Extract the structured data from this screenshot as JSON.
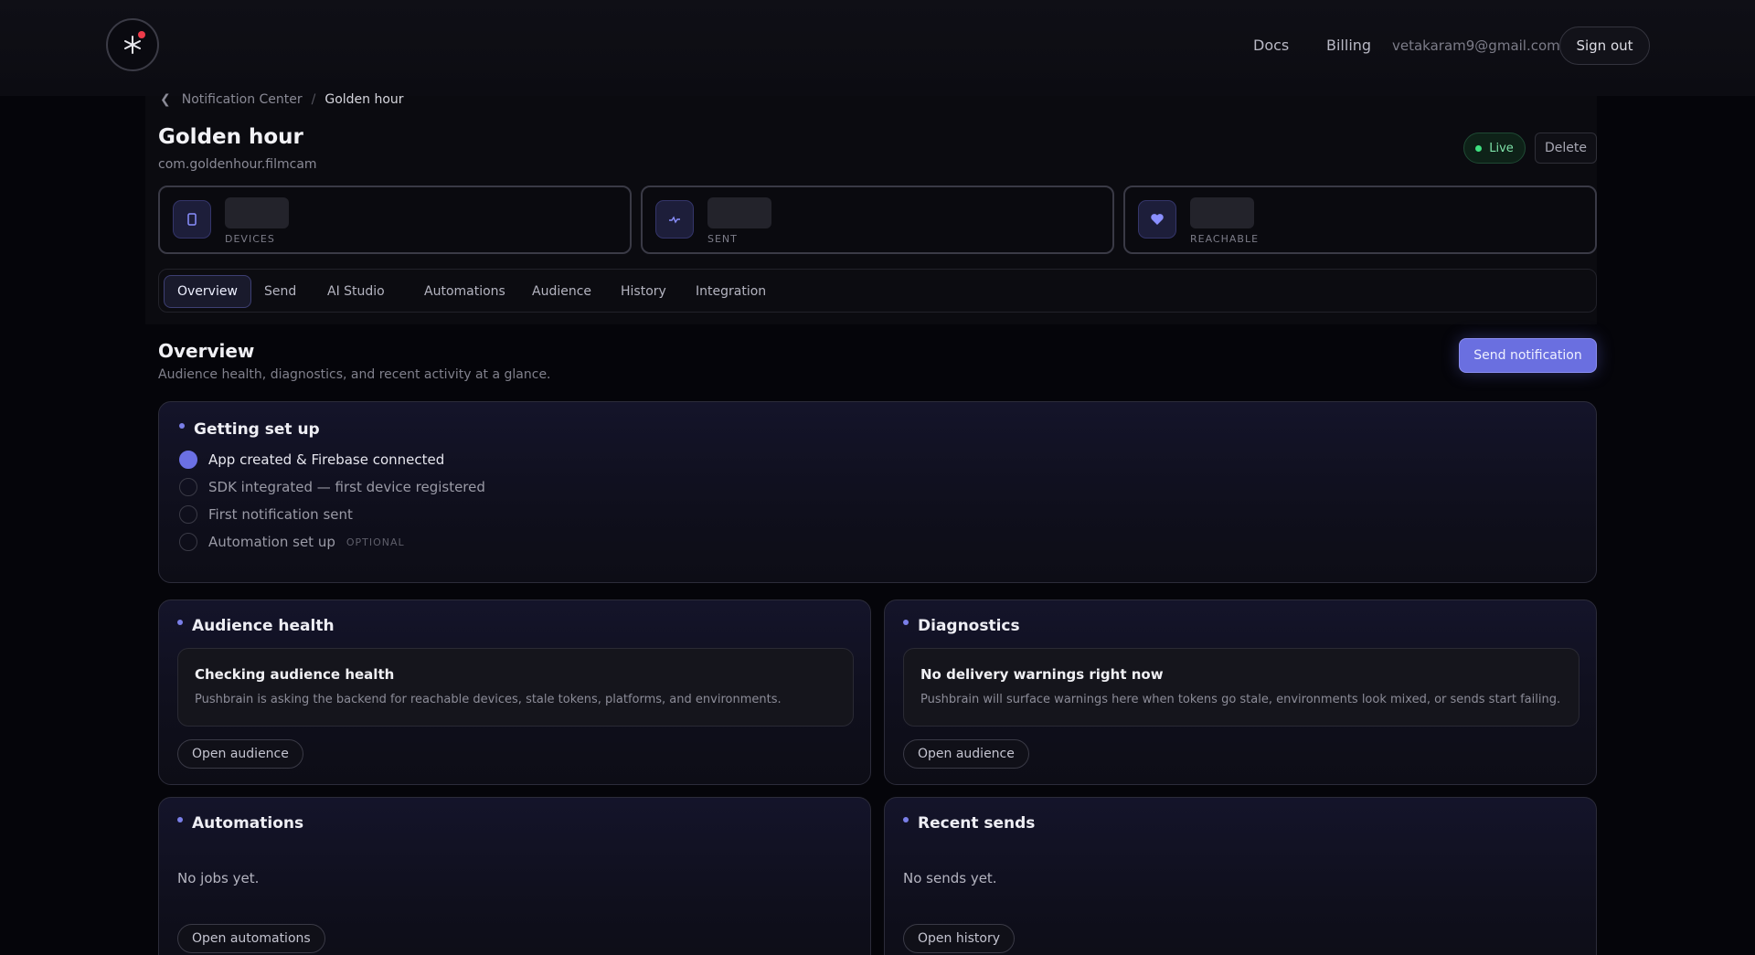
{
  "nav": {
    "docs": "Docs",
    "billing": "Billing",
    "email": "vetakaram9@gmail.com",
    "sign_out": "Sign out"
  },
  "breadcrumb": {
    "parent": "Notification Center",
    "separator": "/",
    "current": "Golden hour"
  },
  "app": {
    "name": "Golden hour",
    "bundle_id": "com.goldenhour.filmcam",
    "status": "Live",
    "delete_label": "Delete"
  },
  "stats": [
    {
      "label": "DEVICES",
      "icon": "phone-icon"
    },
    {
      "label": "SENT",
      "icon": "pulse-icon"
    },
    {
      "label": "REACHABLE",
      "icon": "heart-icon"
    }
  ],
  "tabs": [
    {
      "label": "Overview",
      "active": true
    },
    {
      "label": "Send"
    },
    {
      "label": "AI Studio"
    },
    {
      "label": "Automations"
    },
    {
      "label": "Audience"
    },
    {
      "label": "History"
    },
    {
      "label": "Integration"
    }
  ],
  "overview": {
    "title": "Overview",
    "subtitle": "Audience health, diagnostics, and recent activity at a glance.",
    "send_button": "Send notification"
  },
  "getting_set_up": {
    "title": "Getting set up",
    "items": [
      {
        "label": "App created & Firebase connected",
        "done": true
      },
      {
        "label": "SDK integrated — first device registered",
        "done": false
      },
      {
        "label": "First notification sent",
        "done": false
      },
      {
        "label": "Automation set up",
        "done": false,
        "tag": "OPTIONAL"
      }
    ]
  },
  "audience_health": {
    "title": "Audience health",
    "box_title": "Checking audience health",
    "box_desc": "Pushbrain is asking the backend for reachable devices, stale tokens, platforms, and environments.",
    "button": "Open audience"
  },
  "diagnostics": {
    "title": "Diagnostics",
    "box_title": "No delivery warnings right now",
    "box_desc": "Pushbrain will surface warnings here when tokens go stale, environments look mixed, or sends start failing.",
    "button": "Open audience"
  },
  "automations": {
    "title": "Automations",
    "empty": "No jobs yet.",
    "button": "Open automations"
  },
  "recent_sends": {
    "title": "Recent sends",
    "empty": "No sends yet.",
    "button": "Open history"
  },
  "colors": {
    "accent": "#6a6fe0",
    "live_green": "#3ee07f",
    "logo_dot": "#ee3b4a"
  }
}
